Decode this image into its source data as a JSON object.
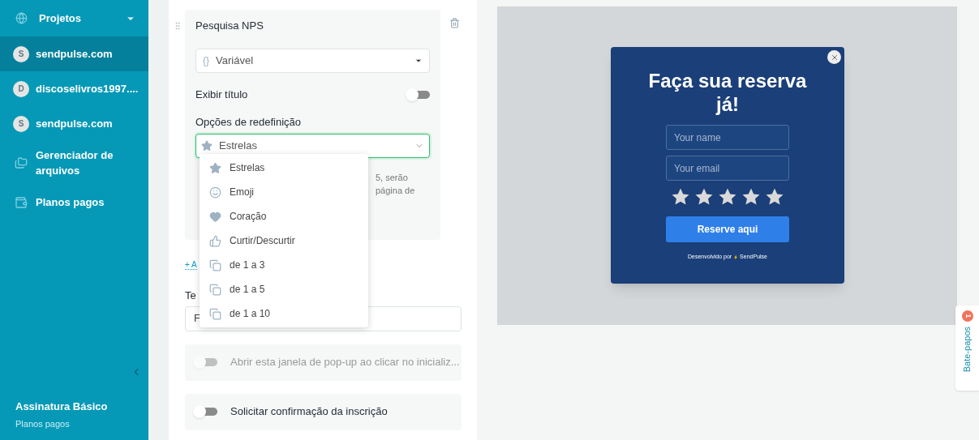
{
  "sidebar": {
    "header": {
      "label": "Projetos"
    },
    "items": [
      {
        "kind": "project",
        "avatar": "S",
        "label": "sendpulse.com",
        "selected": true
      },
      {
        "kind": "project",
        "avatar": "D",
        "label": "discoselivros1997....",
        "selected": false
      },
      {
        "kind": "project",
        "avatar": "S",
        "label": "sendpulse.com",
        "selected": false
      },
      {
        "kind": "files",
        "label": "Gerenciador de arquivos",
        "selected": false
      },
      {
        "kind": "plans",
        "label": "Planos pagos",
        "selected": false
      }
    ],
    "footer": {
      "plan": "Assinatura Básico",
      "link": "Planos pagos"
    }
  },
  "editor": {
    "block": {
      "title": "Pesquisa NPS",
      "variable_select": {
        "icon": "{}",
        "value": "Variável"
      },
      "show_title": {
        "label": "Exibir título",
        "on": false
      },
      "options_label": "Opções de redefinição",
      "options_select": {
        "value": "Estrelas",
        "open": true
      },
      "hint_lines": [
        "5, serão",
        "página de"
      ]
    },
    "dropdown": [
      {
        "kind": "star",
        "label": "Estrelas",
        "selected": false
      },
      {
        "kind": "emoji",
        "label": "Emoji",
        "selected": false
      },
      {
        "kind": "heart",
        "label": "Coração",
        "selected": false
      },
      {
        "kind": "thumb",
        "label": "Curtir/Descurtir",
        "selected": false
      },
      {
        "kind": "scale",
        "label": "de 1 a 3",
        "selected": false
      },
      {
        "kind": "scale",
        "label": "de 1 a 5",
        "selected": false
      },
      {
        "kind": "scale",
        "label": "de 1 a 10",
        "selected": false
      }
    ],
    "add_link": "+ A",
    "text_label": "Te",
    "text_value": "F",
    "toggles": [
      {
        "label": "Abrir esta janela de pop-up ao clicar no inicializ...",
        "on": false,
        "disabled": true
      },
      {
        "label": "Solicitar confirmação da inscrição",
        "on": false,
        "disabled": false
      }
    ]
  },
  "preview": {
    "popup": {
      "title": "Faça sua reserva já!",
      "fields": [
        {
          "placeholder": "Your name"
        },
        {
          "placeholder": "Your email"
        }
      ],
      "button": "Reserve aqui",
      "footer": "Desenvolvido por",
      "brand": "SendPulse"
    }
  },
  "chat_tab": {
    "label": "Bate-papos",
    "badge": "1"
  }
}
